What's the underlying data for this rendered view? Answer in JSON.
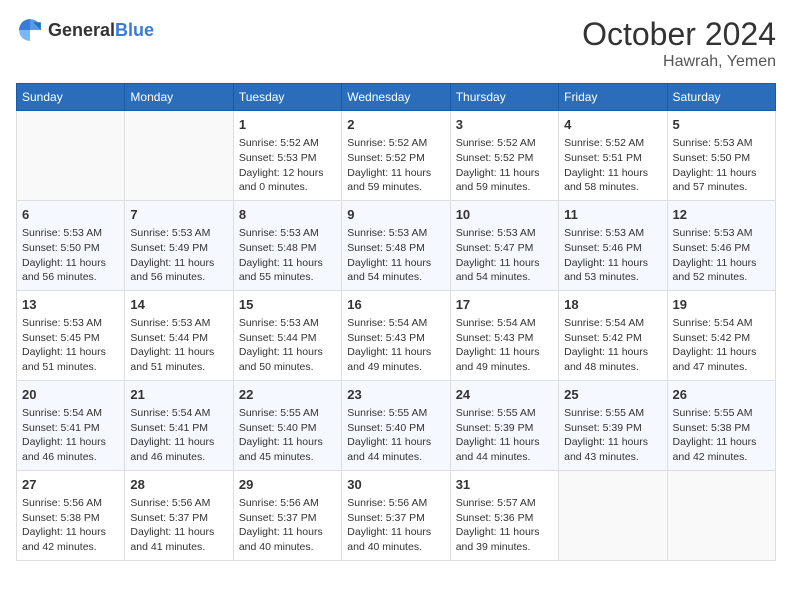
{
  "logo": {
    "general": "General",
    "blue": "Blue"
  },
  "header": {
    "month": "October 2024",
    "location": "Hawrah, Yemen"
  },
  "weekdays": [
    "Sunday",
    "Monday",
    "Tuesday",
    "Wednesday",
    "Thursday",
    "Friday",
    "Saturday"
  ],
  "weeks": [
    [
      {
        "day": null
      },
      {
        "day": null
      },
      {
        "day": "1",
        "sunrise": "Sunrise: 5:52 AM",
        "sunset": "Sunset: 5:53 PM",
        "daylight": "Daylight: 12 hours and 0 minutes."
      },
      {
        "day": "2",
        "sunrise": "Sunrise: 5:52 AM",
        "sunset": "Sunset: 5:52 PM",
        "daylight": "Daylight: 11 hours and 59 minutes."
      },
      {
        "day": "3",
        "sunrise": "Sunrise: 5:52 AM",
        "sunset": "Sunset: 5:52 PM",
        "daylight": "Daylight: 11 hours and 59 minutes."
      },
      {
        "day": "4",
        "sunrise": "Sunrise: 5:52 AM",
        "sunset": "Sunset: 5:51 PM",
        "daylight": "Daylight: 11 hours and 58 minutes."
      },
      {
        "day": "5",
        "sunrise": "Sunrise: 5:53 AM",
        "sunset": "Sunset: 5:50 PM",
        "daylight": "Daylight: 11 hours and 57 minutes."
      }
    ],
    [
      {
        "day": "6",
        "sunrise": "Sunrise: 5:53 AM",
        "sunset": "Sunset: 5:50 PM",
        "daylight": "Daylight: 11 hours and 56 minutes."
      },
      {
        "day": "7",
        "sunrise": "Sunrise: 5:53 AM",
        "sunset": "Sunset: 5:49 PM",
        "daylight": "Daylight: 11 hours and 56 minutes."
      },
      {
        "day": "8",
        "sunrise": "Sunrise: 5:53 AM",
        "sunset": "Sunset: 5:48 PM",
        "daylight": "Daylight: 11 hours and 55 minutes."
      },
      {
        "day": "9",
        "sunrise": "Sunrise: 5:53 AM",
        "sunset": "Sunset: 5:48 PM",
        "daylight": "Daylight: 11 hours and 54 minutes."
      },
      {
        "day": "10",
        "sunrise": "Sunrise: 5:53 AM",
        "sunset": "Sunset: 5:47 PM",
        "daylight": "Daylight: 11 hours and 54 minutes."
      },
      {
        "day": "11",
        "sunrise": "Sunrise: 5:53 AM",
        "sunset": "Sunset: 5:46 PM",
        "daylight": "Daylight: 11 hours and 53 minutes."
      },
      {
        "day": "12",
        "sunrise": "Sunrise: 5:53 AM",
        "sunset": "Sunset: 5:46 PM",
        "daylight": "Daylight: 11 hours and 52 minutes."
      }
    ],
    [
      {
        "day": "13",
        "sunrise": "Sunrise: 5:53 AM",
        "sunset": "Sunset: 5:45 PM",
        "daylight": "Daylight: 11 hours and 51 minutes."
      },
      {
        "day": "14",
        "sunrise": "Sunrise: 5:53 AM",
        "sunset": "Sunset: 5:44 PM",
        "daylight": "Daylight: 11 hours and 51 minutes."
      },
      {
        "day": "15",
        "sunrise": "Sunrise: 5:53 AM",
        "sunset": "Sunset: 5:44 PM",
        "daylight": "Daylight: 11 hours and 50 minutes."
      },
      {
        "day": "16",
        "sunrise": "Sunrise: 5:54 AM",
        "sunset": "Sunset: 5:43 PM",
        "daylight": "Daylight: 11 hours and 49 minutes."
      },
      {
        "day": "17",
        "sunrise": "Sunrise: 5:54 AM",
        "sunset": "Sunset: 5:43 PM",
        "daylight": "Daylight: 11 hours and 49 minutes."
      },
      {
        "day": "18",
        "sunrise": "Sunrise: 5:54 AM",
        "sunset": "Sunset: 5:42 PM",
        "daylight": "Daylight: 11 hours and 48 minutes."
      },
      {
        "day": "19",
        "sunrise": "Sunrise: 5:54 AM",
        "sunset": "Sunset: 5:42 PM",
        "daylight": "Daylight: 11 hours and 47 minutes."
      }
    ],
    [
      {
        "day": "20",
        "sunrise": "Sunrise: 5:54 AM",
        "sunset": "Sunset: 5:41 PM",
        "daylight": "Daylight: 11 hours and 46 minutes."
      },
      {
        "day": "21",
        "sunrise": "Sunrise: 5:54 AM",
        "sunset": "Sunset: 5:41 PM",
        "daylight": "Daylight: 11 hours and 46 minutes."
      },
      {
        "day": "22",
        "sunrise": "Sunrise: 5:55 AM",
        "sunset": "Sunset: 5:40 PM",
        "daylight": "Daylight: 11 hours and 45 minutes."
      },
      {
        "day": "23",
        "sunrise": "Sunrise: 5:55 AM",
        "sunset": "Sunset: 5:40 PM",
        "daylight": "Daylight: 11 hours and 44 minutes."
      },
      {
        "day": "24",
        "sunrise": "Sunrise: 5:55 AM",
        "sunset": "Sunset: 5:39 PM",
        "daylight": "Daylight: 11 hours and 44 minutes."
      },
      {
        "day": "25",
        "sunrise": "Sunrise: 5:55 AM",
        "sunset": "Sunset: 5:39 PM",
        "daylight": "Daylight: 11 hours and 43 minutes."
      },
      {
        "day": "26",
        "sunrise": "Sunrise: 5:55 AM",
        "sunset": "Sunset: 5:38 PM",
        "daylight": "Daylight: 11 hours and 42 minutes."
      }
    ],
    [
      {
        "day": "27",
        "sunrise": "Sunrise: 5:56 AM",
        "sunset": "Sunset: 5:38 PM",
        "daylight": "Daylight: 11 hours and 42 minutes."
      },
      {
        "day": "28",
        "sunrise": "Sunrise: 5:56 AM",
        "sunset": "Sunset: 5:37 PM",
        "daylight": "Daylight: 11 hours and 41 minutes."
      },
      {
        "day": "29",
        "sunrise": "Sunrise: 5:56 AM",
        "sunset": "Sunset: 5:37 PM",
        "daylight": "Daylight: 11 hours and 40 minutes."
      },
      {
        "day": "30",
        "sunrise": "Sunrise: 5:56 AM",
        "sunset": "Sunset: 5:37 PM",
        "daylight": "Daylight: 11 hours and 40 minutes."
      },
      {
        "day": "31",
        "sunrise": "Sunrise: 5:57 AM",
        "sunset": "Sunset: 5:36 PM",
        "daylight": "Daylight: 11 hours and 39 minutes."
      },
      {
        "day": null
      },
      {
        "day": null
      }
    ]
  ]
}
